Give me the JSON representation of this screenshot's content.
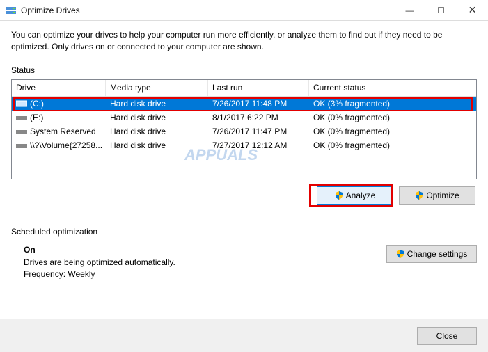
{
  "window": {
    "title": "Optimize Drives",
    "intro": "You can optimize your drives to help your computer run more efficiently, or analyze them to find out if they need to be optimized. Only drives on or connected to your computer are shown."
  },
  "status": {
    "label": "Status",
    "columns": {
      "drive": "Drive",
      "media": "Media type",
      "last": "Last run",
      "status": "Current status"
    },
    "rows": [
      {
        "drive": "(C:)",
        "media": "Hard disk drive",
        "last": "7/26/2017 11:48 PM",
        "status": "OK (3% fragmented)",
        "selected": true
      },
      {
        "drive": "(E:)",
        "media": "Hard disk drive",
        "last": "8/1/2017 6:22 PM",
        "status": "OK (0% fragmented)"
      },
      {
        "drive": "System Reserved",
        "media": "Hard disk drive",
        "last": "7/26/2017 11:47 PM",
        "status": "OK (0% fragmented)"
      },
      {
        "drive": "\\\\?\\Volume{27258...",
        "media": "Hard disk drive",
        "last": "7/27/2017 12:12 AM",
        "status": "OK (0% fragmented)"
      }
    ]
  },
  "buttons": {
    "analyze": "Analyze",
    "optimize": "Optimize",
    "change": "Change settings",
    "close": "Close"
  },
  "sched": {
    "label": "Scheduled optimization",
    "state": "On",
    "desc": "Drives are being optimized automatically.",
    "freq": "Frequency: Weekly"
  },
  "watermark": "APPUALS"
}
